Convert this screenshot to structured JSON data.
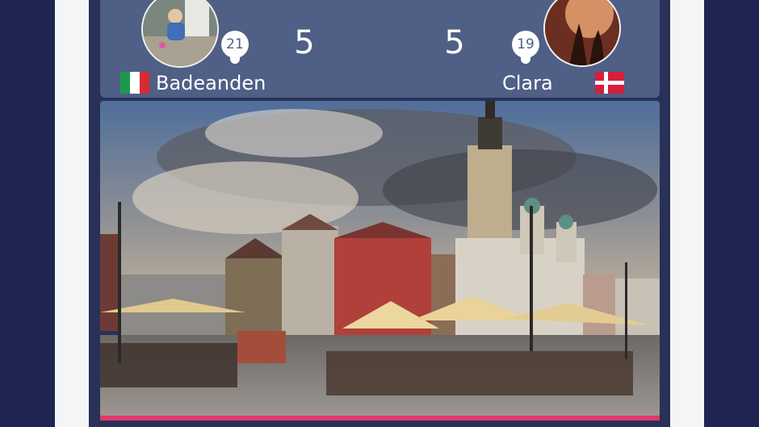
{
  "match": {
    "player1": {
      "name": "Badeanden",
      "badge": "21",
      "score": "5",
      "flag_icon": "italy-flag-icon"
    },
    "player2": {
      "name": "Clara",
      "badge": "19",
      "score": "5",
      "flag_icon": "denmark-flag-icon"
    }
  },
  "photo": {
    "subject": "city-square-photo"
  },
  "progress": {
    "fraction": 1.0
  },
  "colors": {
    "background": "#1c2350",
    "score_bar": "#4f5f86",
    "progress": "#e4366a"
  }
}
